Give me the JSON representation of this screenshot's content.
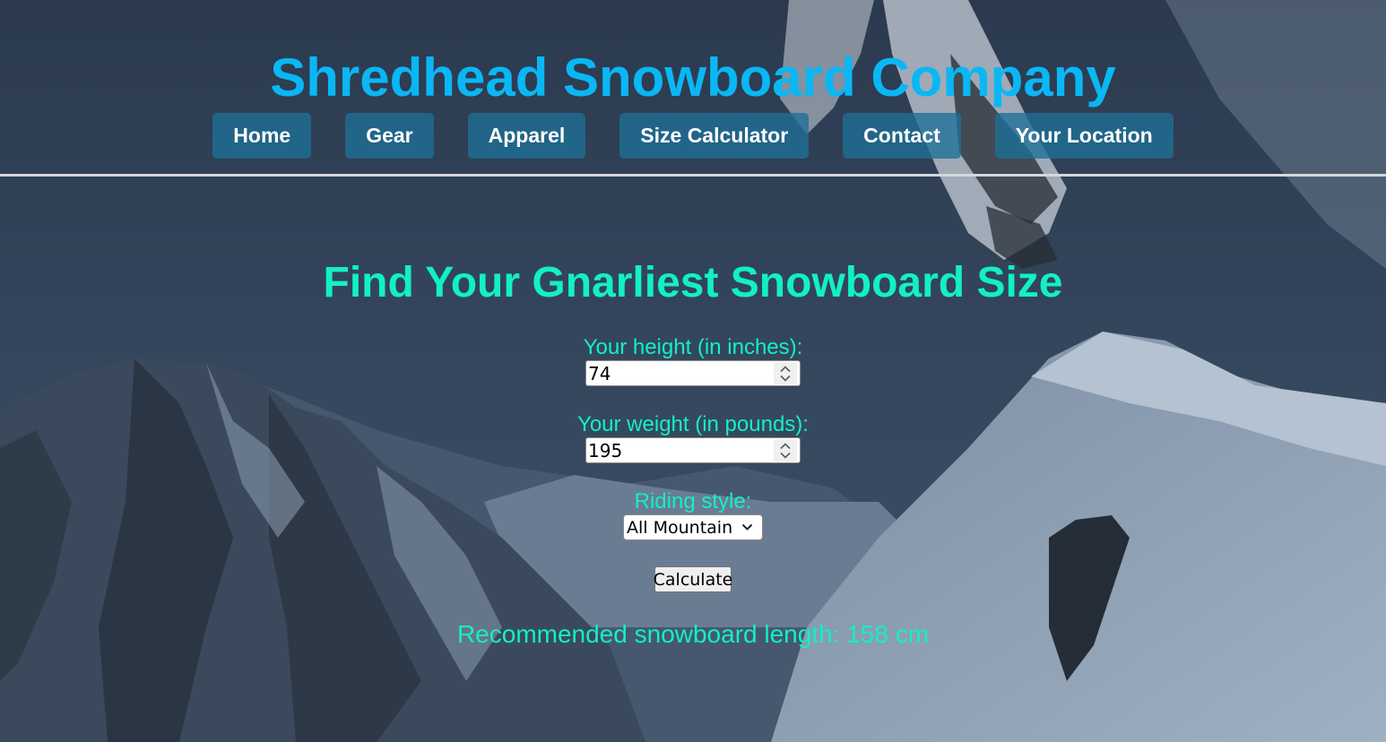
{
  "header": {
    "title": "Shredhead Snowboard Company",
    "nav": [
      {
        "label": "Home"
      },
      {
        "label": "Gear"
      },
      {
        "label": "Apparel"
      },
      {
        "label": "Size Calculator"
      },
      {
        "label": "Contact"
      },
      {
        "label": "Your Location"
      }
    ]
  },
  "calculator": {
    "heading": "Find Your Gnarliest Snowboard Size",
    "height_label": "Your height (in inches):",
    "height_value": "74",
    "weight_label": "Your weight (in pounds):",
    "weight_value": "195",
    "style_label": "Riding style:",
    "style_selected": "All Mountain",
    "calculate_label": "Calculate",
    "result_text": "Recommended snowboard length: 158 cm"
  },
  "icons": {
    "spinner": "spinner-arrows-icon",
    "dropdown": "chevron-down-icon"
  },
  "colors": {
    "title": "#0ab7f5",
    "accent": "#12f0c5",
    "nav_button": "#1d6f97",
    "nav_text": "#ffffff"
  }
}
